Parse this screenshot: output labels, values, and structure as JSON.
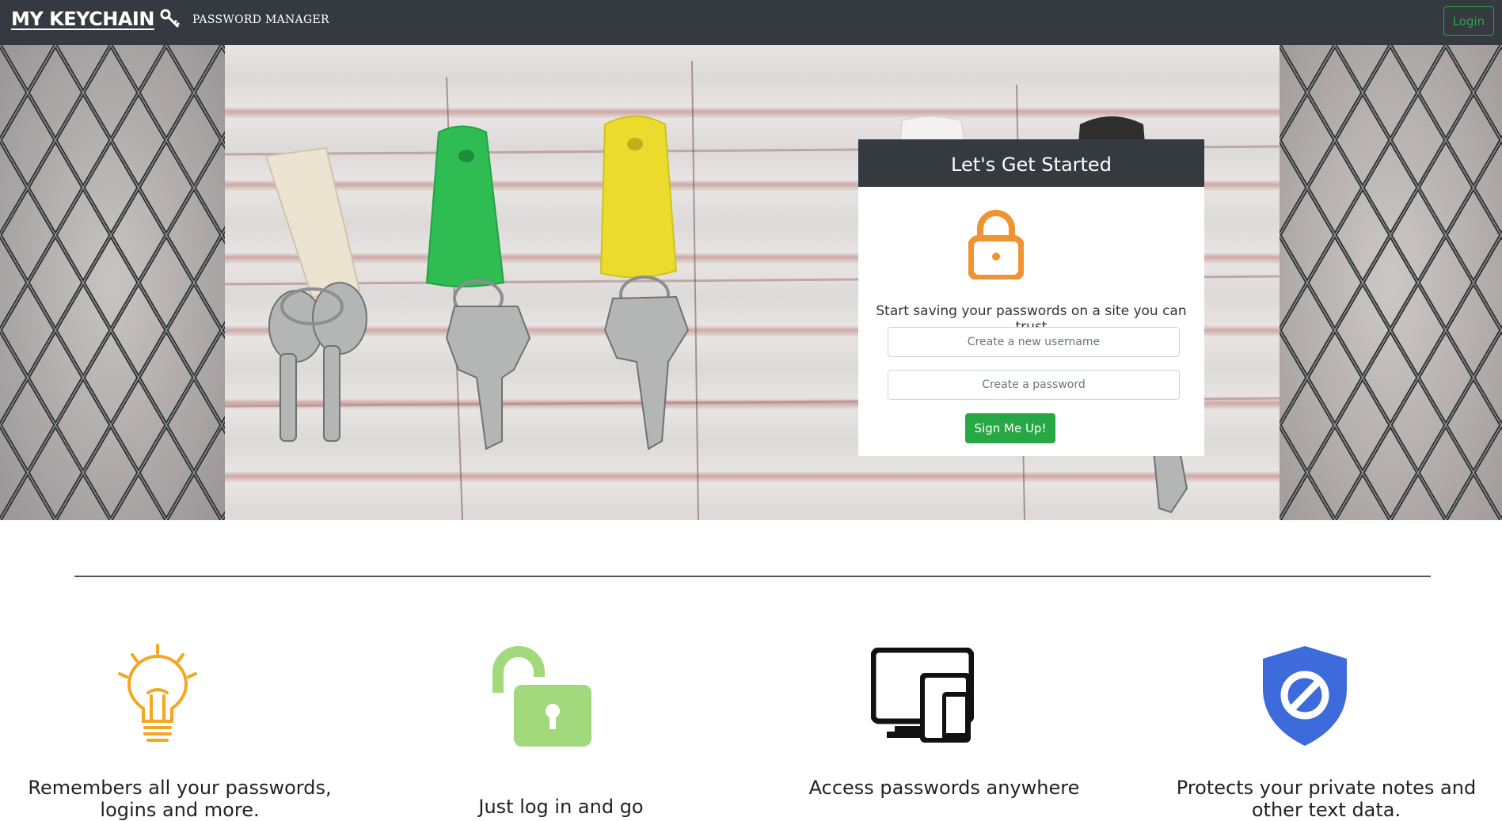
{
  "navbar": {
    "brand": "MY KEYCHAIN",
    "tagline": "PASSWORD MANAGER",
    "login_label": "Login"
  },
  "signup": {
    "title": "Let's Get Started",
    "subtitle": "Start saving your passwords on a site you can trust",
    "username_placeholder": "Create a new username",
    "password_placeholder": "Create a password",
    "submit_label": "Sign Me Up!"
  },
  "features": [
    {
      "icon": "lightbulb-icon",
      "text": "Remembers all your passwords, logins and more."
    },
    {
      "icon": "unlock-icon",
      "text": "Just log in and go"
    },
    {
      "icon": "devices-icon",
      "text": "Access passwords anywhere"
    },
    {
      "icon": "shield-icon",
      "text": "Protects your private notes and other text data."
    }
  ],
  "colors": {
    "navbar_bg": "#343a40",
    "accent_green": "#28a745",
    "lock_orange": "#ef9333",
    "bulb_orange": "#f5a623",
    "unlock_green": "#a2d97d",
    "shield_blue": "#3d6bdb"
  }
}
